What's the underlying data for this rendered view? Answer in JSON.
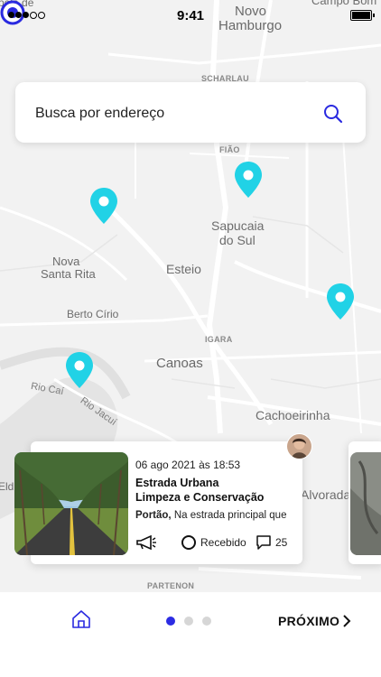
{
  "status_bar": {
    "time": "9:41",
    "carrier": ""
  },
  "search": {
    "placeholder": "Busca por endereço"
  },
  "map": {
    "labels": {
      "velha": "pela de",
      "novo_hamburgo_1": "Novo",
      "novo_hamburgo_2": "Hamburgo",
      "campo_bom": "Campo Bom",
      "scharlau": "SCHARLAU",
      "fiao": "FIÃO",
      "sapucaia_1": "Sapucaia",
      "sapucaia_2": "do Sul",
      "nova_santa_rita_1": "Nova",
      "nova_santa_rita_2": "Santa Rita",
      "esteio": "Esteio",
      "berto_cirio": "Berto Círio",
      "igara": "IGARA",
      "canoas": "Canoas",
      "rio_cai": "Rio Caí",
      "rio_jacui": "Rio Jacuí",
      "cachoeirinha": "Cachoeirinha",
      "alvorada": "Alvorada",
      "eldo": "Eld",
      "parteno": "PARTENON"
    },
    "pin_color": "#21d2e6",
    "location_color": "#2a2ae0"
  },
  "card": {
    "date": "06 ago 2021 às 18:53",
    "title_line1": "Estrada Urbana",
    "title_line2": "Limpeza e Conservação",
    "desc_bold": "Portão,",
    "desc_text": " Na estrada principal que",
    "status": "Recebido",
    "comments": "25"
  },
  "bottom_bar": {
    "next_label": "PRÓXIMO",
    "page_count": 3,
    "active_page": 1
  }
}
